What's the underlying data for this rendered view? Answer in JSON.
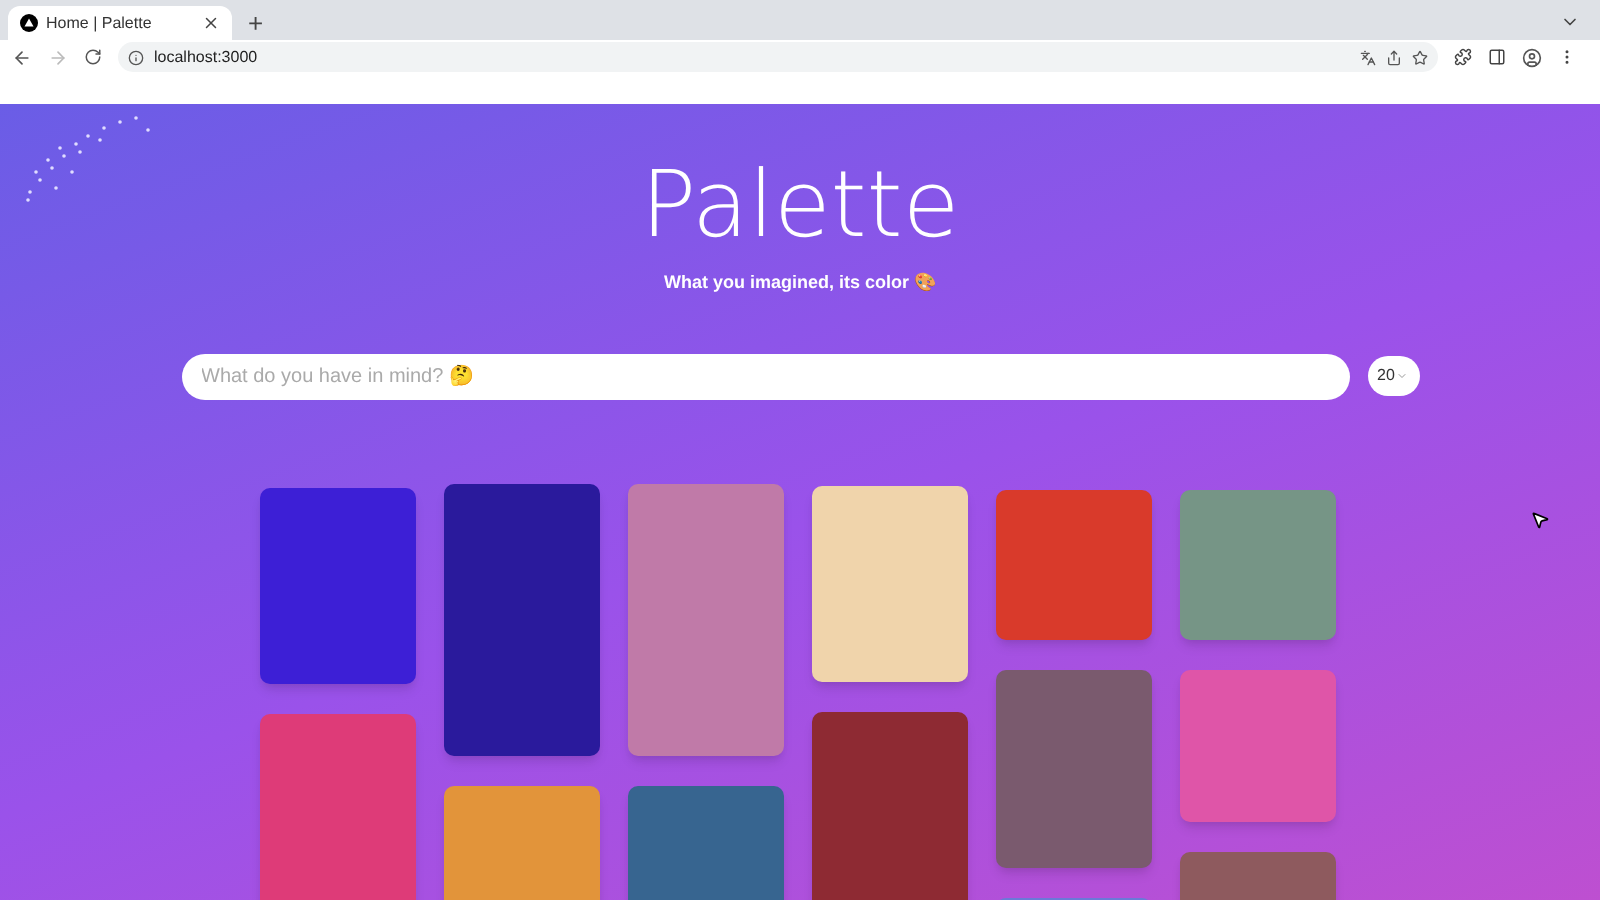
{
  "browser": {
    "tab": {
      "title": "Home | Palette",
      "selected": true
    },
    "new_tab": "+",
    "address": "localhost:3000"
  },
  "hero": {
    "title": "Palette",
    "subtitle": "What you imagined, its color 🎨"
  },
  "search": {
    "placeholder": "What do you have in mind? 🤔"
  },
  "count_select": {
    "value": "20"
  },
  "columns": [
    {
      "swatches": [
        {
          "color": "#3d1fd6"
        },
        {
          "color": "#de3b78"
        }
      ]
    },
    {
      "swatches": [
        {
          "color": "#2a1a9c"
        },
        {
          "color": "#e2943a"
        }
      ]
    },
    {
      "swatches": [
        {
          "color": "#c07aa8"
        },
        {
          "color": "#376590"
        }
      ]
    },
    {
      "swatches": [
        {
          "color": "#f0d4ab"
        },
        {
          "color": "#8e2a33"
        }
      ]
    },
    {
      "swatches": [
        {
          "color": "#d93a2b"
        },
        {
          "color": "#7a5a6e"
        },
        {
          "color": "#6a7ad8"
        }
      ]
    },
    {
      "swatches": [
        {
          "color": "#769586"
        },
        {
          "color": "#df55a8"
        },
        {
          "color": "#8e5a5e"
        }
      ]
    }
  ]
}
